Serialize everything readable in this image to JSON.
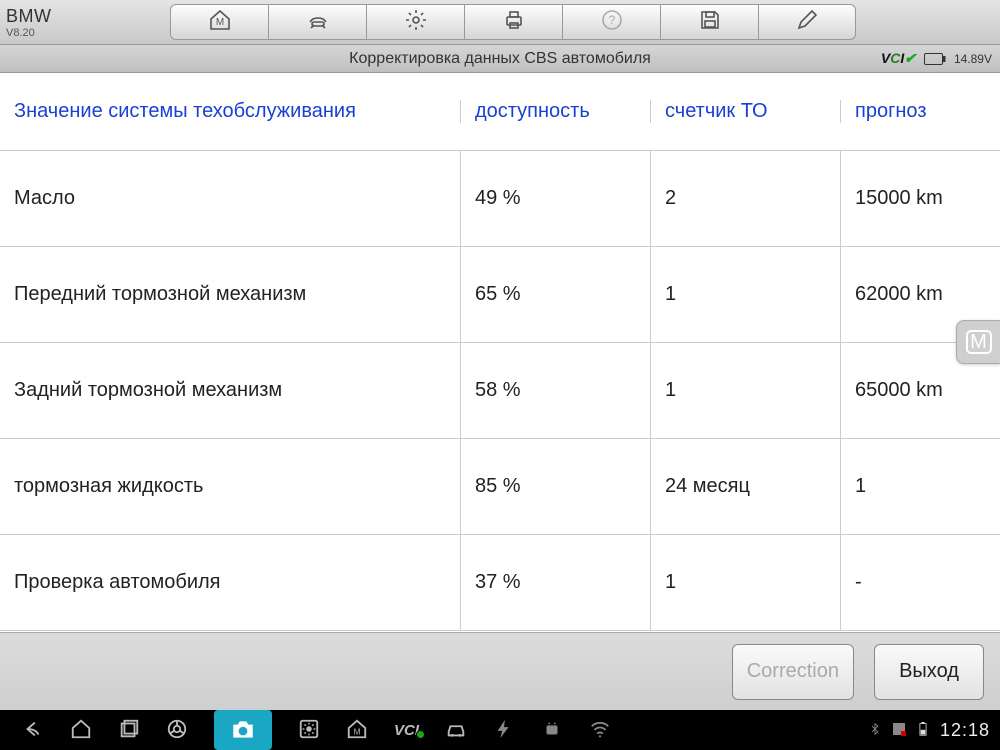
{
  "brand": {
    "name": "BMW",
    "version": "V8.20"
  },
  "subheader": {
    "title": "Корректировка данных CBS автомобиля",
    "vci": "VCI",
    "voltage": "14.89V"
  },
  "columns": {
    "c1": "Значение системы техобслуживания",
    "c2": "доступность",
    "c3": "счетчик ТО",
    "c4": "прогноз"
  },
  "rows": [
    {
      "c1": "Масло",
      "c2": "49 %",
      "c3": "2",
      "c4": "15000 km"
    },
    {
      "c1": "Передний тормозной механизм",
      "c2": "65 %",
      "c3": "1",
      "c4": "62000 km"
    },
    {
      "c1": "Задний тормозной механизм",
      "c2": "58 %",
      "c3": "1",
      "c4": "65000 km"
    },
    {
      "c1": "тормозная жидкость",
      "c2": "85 %",
      "c3": " 24 месяц",
      "c4": " 1"
    },
    {
      "c1": "Проверка автомобиля",
      "c2": "37 %",
      "c3": "1",
      "c4": "-"
    }
  ],
  "buttons": {
    "correction": "Correction",
    "exit": "Выход"
  },
  "clock": "12:18"
}
